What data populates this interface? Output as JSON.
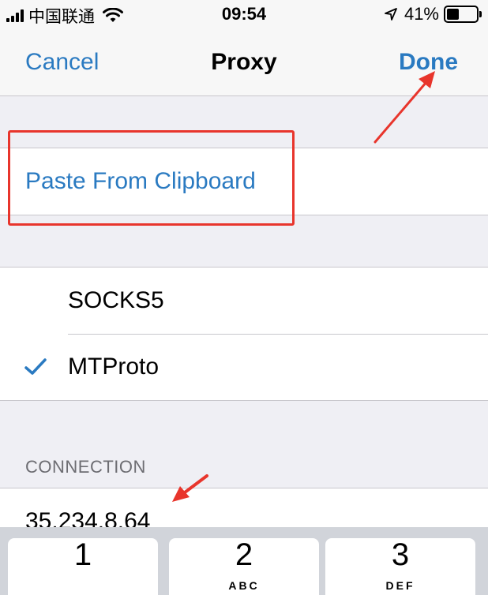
{
  "status_bar": {
    "carrier": "中国联通",
    "time": "09:54",
    "battery_percent": "41%",
    "battery_level": 0.41,
    "icons": [
      "signal-bars-icon",
      "wifi-icon",
      "location-arrow-icon",
      "battery-icon"
    ]
  },
  "nav": {
    "left_label": "Cancel",
    "title": "Proxy",
    "right_label": "Done"
  },
  "paste_section": {
    "action_label": "Paste From Clipboard"
  },
  "proxy_types": {
    "options": [
      {
        "label": "SOCKS5",
        "selected": false
      },
      {
        "label": "MTProto",
        "selected": true
      }
    ]
  },
  "connection": {
    "header": "CONNECTION",
    "server_value": "35.234.8.64"
  },
  "keyboard": {
    "keys": [
      {
        "digit": "1",
        "letters": ""
      },
      {
        "digit": "2",
        "letters": "ABC"
      },
      {
        "digit": "3",
        "letters": "DEF"
      }
    ]
  },
  "colors": {
    "accent": "#2a7ac1",
    "annotation": "#e8352c",
    "group_background": "#efeff4"
  }
}
